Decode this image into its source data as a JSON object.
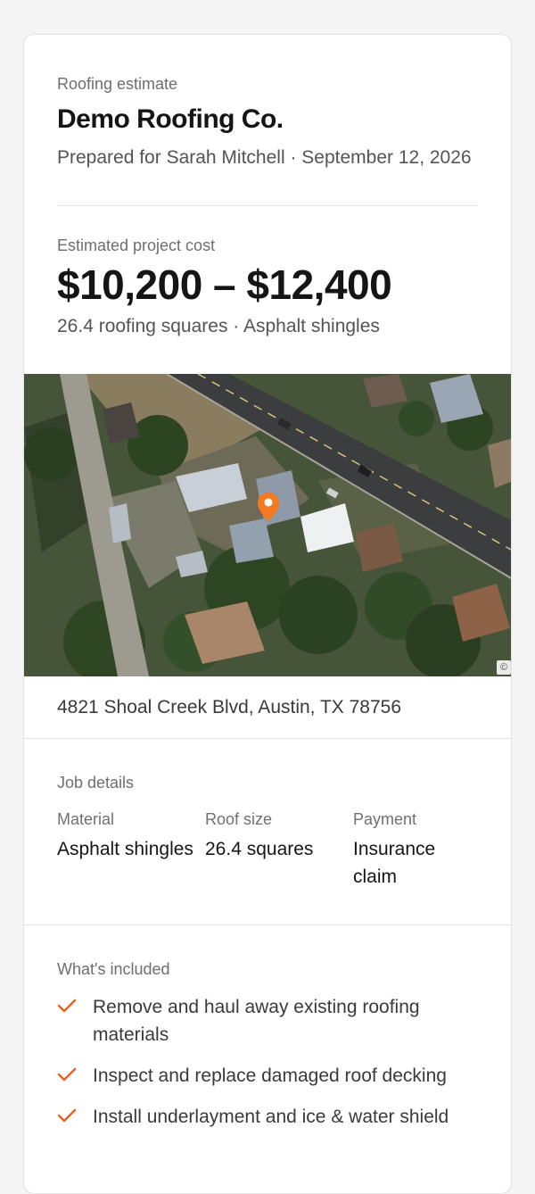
{
  "estimate": {
    "eyebrow": "Roofing estimate",
    "company": "Demo Roofing Co.",
    "prepared": "Prepared for Sarah Mitchell · September 12, 2026"
  },
  "cost": {
    "label": "Estimated project cost",
    "range": "$10,200 – $12,400",
    "summary": "26.4 roofing squares · Asphalt shingles"
  },
  "map": {
    "attribution_icon": "copyright-icon",
    "pin_color": "#f47a20",
    "pin_icon": "map-pin-icon"
  },
  "address": "4821 Shoal Creek Blvd, Austin, TX 78756",
  "job_details": {
    "title": "Job details",
    "items": [
      {
        "label": "Material",
        "value": "Asphalt shingles"
      },
      {
        "label": "Roof size",
        "value": "26.4 squares"
      },
      {
        "label": "Payment",
        "value": "Insurance claim"
      }
    ]
  },
  "included": {
    "title": "What's included",
    "check_color": "#e8621a",
    "items": [
      "Remove and haul away existing roofing materials",
      "Inspect and replace damaged roof decking",
      "Install underlayment and ice & water shield"
    ]
  }
}
